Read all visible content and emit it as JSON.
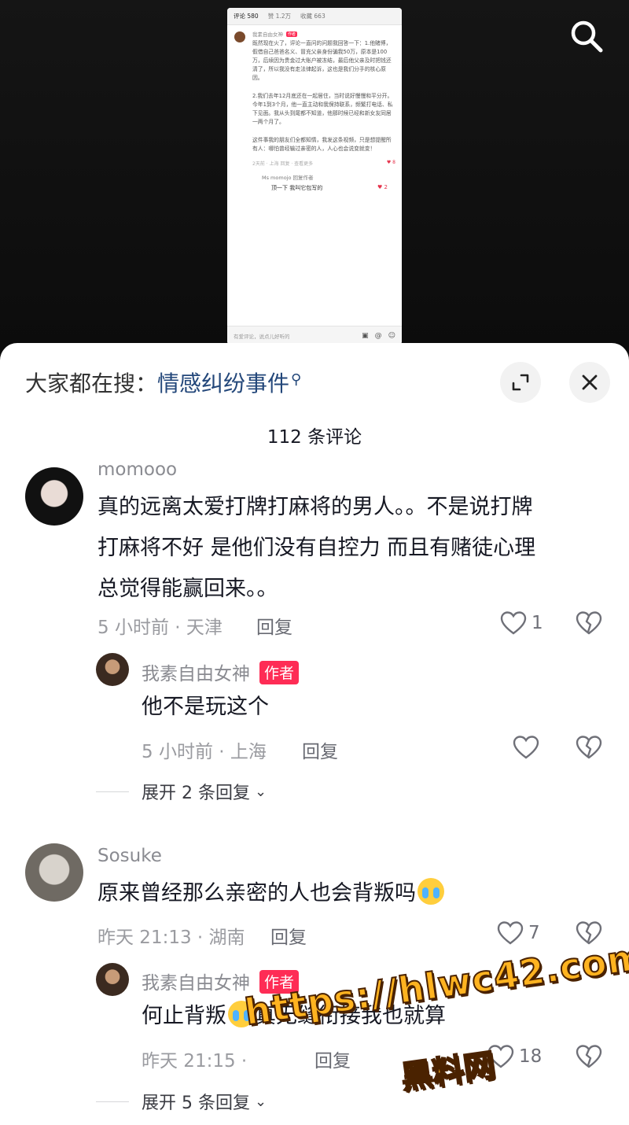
{
  "embedded": {
    "tabs": [
      "评论 580",
      "赞 1.2万",
      "收藏 663"
    ],
    "author": "我素自由女神",
    "author_badge": "作者",
    "paragraphs": [
      "既然现在火了，评论一直问的问题我回答一下：1.他赌博，假借自己爸爸名义、冒充父亲身份骗我50万，原本是100万，后续因为贵金过大账户被冻结，最后他父亲及时把钱还清了，所以我没有走法律起诉，这也是我们分手的核心原因。",
      "2.我们去年12月底还在一起居住，当时说好慢慢和平分开。今年1到3个月，他一直主动和我保持联系，频繁打电话、私下见面。我从头到尾都不知道，他那时候已经和新女友同居一两个月了。",
      "这件事我的朋友们全都知情，我发这条视频，只是想提醒所有人：哪怕曾经输过亲密的人，人心也会说变就变！"
    ],
    "meta": "2天前 · 上海  回复  ·  查看更多",
    "likes_1": "8",
    "reply_user": "Ms momojo  回复作者",
    "reply_text": "顶一下 我叫它包写的",
    "likes_2": "2",
    "input_placeholder": "有爱评论，说点儿好听的"
  },
  "sheet": {
    "search_prefix": "大家都在搜：",
    "search_keyword": "情感纠纷事件",
    "count": "112 条评论"
  },
  "comments": [
    {
      "user": "momooo",
      "text": [
        "真的远离太爱打牌打麻将的男人。。不是说打牌",
        "打麻将不好 是他们没有自控力 而且有赌徒心理",
        "总觉得能赢回来。。"
      ],
      "meta": "5 小时前 · 天津",
      "reply_label": "回复",
      "likes": "1",
      "reply": {
        "user": "我素自由女神",
        "badge": "作者",
        "text": "他不是玩这个",
        "meta": "5 小时前 · 上海",
        "reply_label": "回复",
        "likes": ""
      },
      "expand": "展开 2 条回复"
    },
    {
      "user": "Sosuke",
      "text": [
        "原来曾经那么亲密的人也会背叛吗"
      ],
      "meta": "昨天 21:13 · 湖南",
      "reply_label": "回复",
      "likes": "7",
      "reply": {
        "user": "我素自由女神",
        "badge": "作者",
        "text_a": "何止背叛",
        "text_b": "真无缝衔接我也就算",
        "meta": "昨天 21:15 · ",
        "reply_label": "回复",
        "likes": "18"
      },
      "expand": "展开 5 条回复"
    }
  ],
  "watermark": {
    "url": "https://hlwc42.com",
    "name": "黑料网"
  },
  "icons": {
    "top_search": "search-icon",
    "expand": "expand-icon",
    "close": "close-icon",
    "like": "heart-icon",
    "dislike": "broken-heart-icon",
    "emoji": "crying-emoji-icon"
  },
  "colors": {
    "accent": "#fe2c55",
    "keyword": "#23477a"
  }
}
